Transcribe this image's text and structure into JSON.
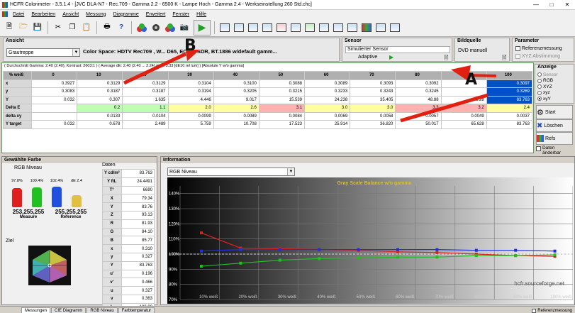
{
  "window": {
    "title": "HCFR Colorimeter - 3.5.1.4 - [JVC DLA-N7 - Rec.709 - Gamma 2.2 - 6500 K - Lampe Hoch - Gamma 2.4 - Werkseinstellung 260 Std.chc]"
  },
  "menu": [
    "Datei",
    "Bearbeiten",
    "Ansicht",
    "Messung",
    "Diagramme",
    "Erweitert",
    "Fenster",
    "Hilfe"
  ],
  "ansicht": {
    "label": "Ansicht",
    "selected": "Grautreppe",
    "colorspace": "Color Space: HDTV Rec709 , W... D65, EOTF:  SDR, BT.1886 w/default gamm..."
  },
  "sensor": {
    "label": "Sensor",
    "name": "Simulierter Sensor",
    "mode": "Adaptive"
  },
  "bildquelle": {
    "label": "Bildquelle",
    "value": "DVD manuell"
  },
  "parameter": {
    "label": "Parameter",
    "items": [
      "Referenzmessung",
      "XYZ Abstimmung"
    ]
  },
  "summary": "( Durchschnitt Gamma: 2.40 (2.40), Kontrast: 2603:1 ) ( Average dE: 2.40 (2.40 ... 2.24) max: 3.33 [dE10 rel lum] ) [Absolute Y w/o gamma]",
  "table": {
    "headers": [
      "% weiß",
      "0",
      "10",
      "20",
      "30",
      "40",
      "50",
      "60",
      "70",
      "80",
      "90",
      "100"
    ],
    "rows": [
      {
        "label": "x",
        "cells": [
          "0.3927",
          "0.3129",
          "0.3129",
          "0.3104",
          "0.3100",
          "0.3088",
          "0.3089",
          "0.3093",
          "0.3092",
          "",
          "0.3097"
        ]
      },
      {
        "label": "y",
        "cells": [
          "0.3083",
          "0.3187",
          "0.3187",
          "0.3194",
          "0.3205",
          "0.3215",
          "0.3233",
          "0.3243",
          "0.3245",
          "",
          "0.3269"
        ]
      },
      {
        "label": "Y",
        "cells": [
          "0.032",
          "0.307",
          "1.635",
          "4.446",
          "9.017",
          "15.539",
          "24.238",
          "35.405",
          "48.88",
          "65.28",
          "83.763"
        ]
      },
      {
        "label": "Delta E",
        "cells": [
          "",
          "0.2",
          "1.1",
          "2.0",
          "2.6",
          "3.1",
          "3.0",
          "3.0",
          "3.3",
          "3.2",
          "2.4"
        ]
      },
      {
        "label": "delta xy",
        "cells": [
          "",
          "0.0133",
          "0.0104",
          "0.0099",
          "0.0089",
          "0.0084",
          "0.0069",
          "0.0058",
          "0.0057",
          "0.0049",
          "0.0037"
        ]
      },
      {
        "label": "Y target",
        "cells": [
          "0.032",
          "0.678",
          "2.489",
          "5.759",
          "10.708",
          "17.523",
          "25.914",
          "36.820",
          "50.017",
          "65.628",
          "83.763"
        ]
      }
    ]
  },
  "anzeige": {
    "label": "Anzeige",
    "options": [
      "Sensor",
      "RGB",
      "XYZ",
      "xyz",
      "xyY"
    ],
    "selected": "xyY"
  },
  "buttons": {
    "start": "Start",
    "loeschen": "Löschen",
    "refs": "Refs",
    "daten": "Daten änderbar"
  },
  "gewaehlte": {
    "label": "Gewählte Farbe",
    "rgb_niveau": "RGB Niveau",
    "bars": [
      {
        "pct": "97.8%",
        "color": "#e02020",
        "level": 0.978
      },
      {
        "pct": "100.4%",
        "color": "#20c020",
        "level": 1.004
      },
      {
        "pct": "102.4%",
        "color": "#2050e0",
        "level": 1.024
      },
      {
        "pct": "dE 2.4",
        "color": "#e0c040",
        "level": 0.6
      }
    ],
    "measure_val": "253,255,255",
    "measure_lab": "Measure",
    "reference_val": "255,255,255",
    "reference_lab": "Reference",
    "ziel": "Ziel"
  },
  "daten": {
    "label": "Daten",
    "rows": [
      [
        "Y cd/m²",
        "83.763"
      ],
      [
        "Y ftL",
        "24.4491"
      ],
      [
        "T°",
        "6690"
      ],
      [
        "X",
        "79.34"
      ],
      [
        "Y",
        "83.76"
      ],
      [
        "Z",
        "93.13"
      ],
      [
        "R",
        "81.93"
      ],
      [
        "G",
        "84.10"
      ],
      [
        "B",
        "85.77"
      ],
      [
        "x",
        "0.310"
      ],
      [
        "y",
        "0.327"
      ],
      [
        "Y",
        "83.763"
      ],
      [
        "u'",
        "0.196"
      ],
      [
        "v'",
        "0.466"
      ],
      [
        "u",
        "0.327"
      ],
      [
        "v",
        "0.363"
      ],
      [
        "L",
        "100.00"
      ]
    ]
  },
  "info": {
    "label": "Information",
    "selected": "RGB Niveau",
    "chart_title": "Gray Scale Balance w/o gamma",
    "watermark": "hcfr.sourceforge.net"
  },
  "chart_data": {
    "type": "line",
    "title": "Gray Scale Balance w/o gamma",
    "x": [
      "10% weiß",
      "20% weiß",
      "30% weiß",
      "40% weiß",
      "50% weiß",
      "60% weiß",
      "70% weiß",
      "80% weiß",
      "90% weiß",
      "100% weiß"
    ],
    "ylim": [
      70,
      145
    ],
    "yticks": [
      "140%",
      "130%",
      "120%",
      "110%",
      "100%",
      "90%",
      "80%",
      "70%"
    ],
    "series": [
      {
        "color": "#e02020",
        "values": [
          114,
          104,
          103.5,
          103,
          102.5,
          101.5,
          101,
          100,
          99,
          98.5
        ]
      },
      {
        "color": "#20c020",
        "values": [
          92,
          94,
          96,
          97,
          97.5,
          98,
          98,
          99,
          99,
          99.5
        ]
      },
      {
        "color": "#2030e0",
        "values": [
          102,
          103,
          103,
          103,
          103,
          103,
          103,
          102.5,
          102.5,
          102
        ]
      }
    ]
  },
  "status": {
    "tabs": [
      "Messungen",
      "CIE Diagramm",
      "RGB Niveau",
      "Farbtemperatur"
    ],
    "right": "Referenzmessung"
  },
  "annotations": {
    "a": "A",
    "b": "B"
  }
}
